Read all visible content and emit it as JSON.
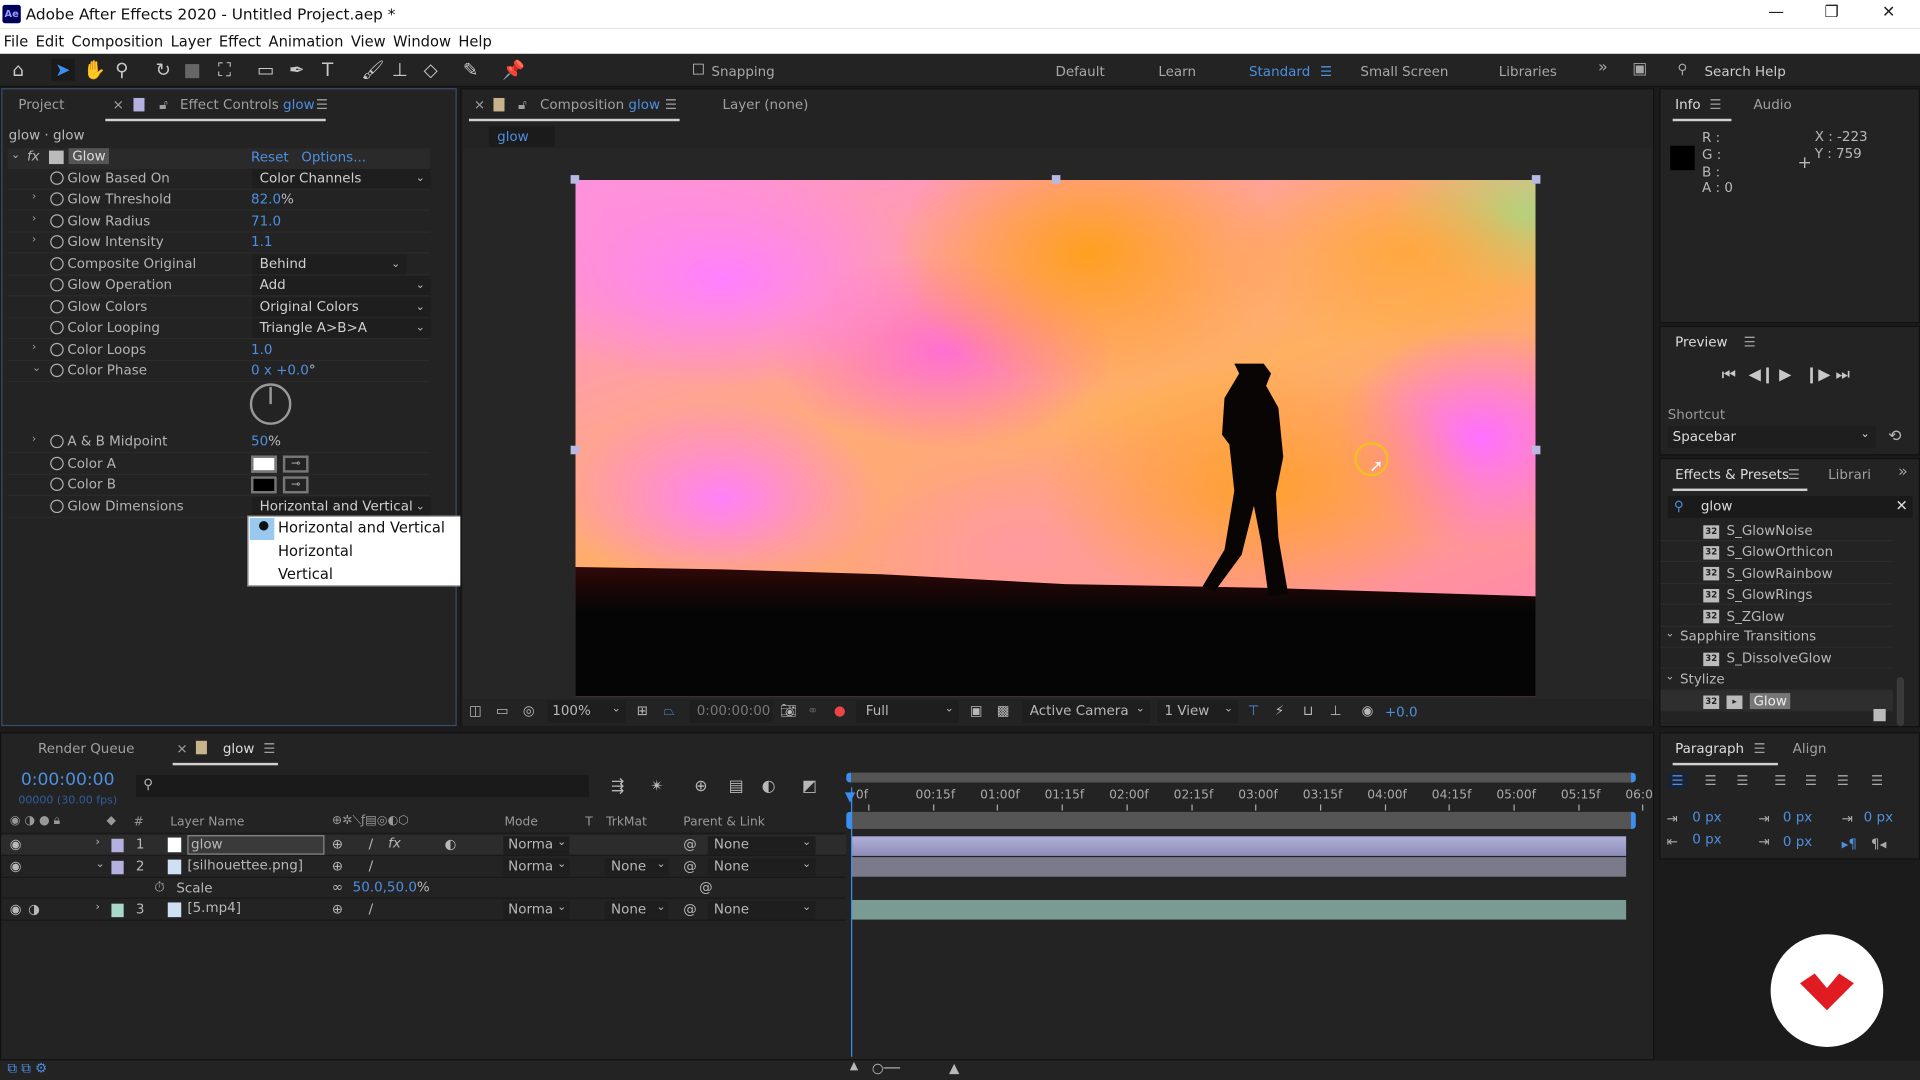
{
  "window": {
    "title": "Adobe After Effects 2020 - Untitled Project.aep *",
    "app_icon": "Ae",
    "controls": [
      "minimize",
      "restore",
      "close"
    ]
  },
  "menu": [
    "File",
    "Edit",
    "Composition",
    "Layer",
    "Effect",
    "Animation",
    "View",
    "Window",
    "Help"
  ],
  "toolbar": {
    "snapping": "Snapping",
    "workspaces": [
      "Default",
      "Learn",
      "Standard",
      "Small Screen",
      "Libraries"
    ],
    "active_workspace": "Standard",
    "search_help": "Search Help"
  },
  "left_panel": {
    "tab_project": "Project",
    "tab_effect_controls": "Effect Controls",
    "tab_effect_target": "glow",
    "breadcrumb": "glow · glow",
    "effect": {
      "name": "Glow",
      "reset": "Reset",
      "options": "Options...",
      "params": [
        {
          "label": "Glow Based On",
          "type": "dropdown",
          "value": "Color Channels"
        },
        {
          "label": "Glow Threshold",
          "type": "number",
          "value": "82.0",
          "unit": "%"
        },
        {
          "label": "Glow Radius",
          "type": "number",
          "value": "71.0"
        },
        {
          "label": "Glow Intensity",
          "type": "number",
          "value": "1.1"
        },
        {
          "label": "Composite Original",
          "type": "dropdown",
          "value": "Behind"
        },
        {
          "label": "Glow Operation",
          "type": "dropdown",
          "value": "Add"
        },
        {
          "label": "Glow Colors",
          "type": "dropdown",
          "value": "Original Colors"
        },
        {
          "label": "Color Looping",
          "type": "dropdown",
          "value": "Triangle A>B>A"
        },
        {
          "label": "Color Loops",
          "type": "number",
          "value": "1.0"
        },
        {
          "label": "Color Phase",
          "type": "angle",
          "value": "0 x +0.0",
          "unit": "°"
        },
        {
          "label": "A & B Midpoint",
          "type": "number",
          "value": "50",
          "unit": "%"
        },
        {
          "label": "Color A",
          "type": "color",
          "value": "#ffffff"
        },
        {
          "label": "Color B",
          "type": "color",
          "value": "#000000"
        },
        {
          "label": "Glow Dimensions",
          "type": "dropdown",
          "value": "Horizontal and Vertical"
        }
      ]
    },
    "dropdown_menu": {
      "options": [
        "Horizontal and Vertical",
        "Horizontal",
        "Vertical"
      ],
      "selected": "Horizontal and Vertical"
    }
  },
  "composition": {
    "tab_label": "Composition",
    "tab_target": "glow",
    "layer_tab": "Layer  (none)",
    "sub_tab": "glow",
    "footer": {
      "zoom": "100%",
      "timecode": "0:00:00:00",
      "resolution": "Full",
      "camera": "Active Camera",
      "views": "1 View",
      "exposure": "+0.0"
    }
  },
  "info": {
    "tab": "Info",
    "tab_audio": "Audio",
    "r": "R :",
    "g": "G :",
    "b": "B :",
    "a": "A :",
    "a_value": "0",
    "x": "X : -223",
    "y": "Y : 759"
  },
  "preview": {
    "title": "Preview",
    "shortcut_label": "Shortcut",
    "shortcut_value": "Spacebar"
  },
  "effects_presets": {
    "tab": "Effects & Presets",
    "tab_libraries": "Librari",
    "search": "glow",
    "items": [
      {
        "label": "S_GlowNoise",
        "kind": "effect"
      },
      {
        "label": "S_GlowOrthicon",
        "kind": "effect"
      },
      {
        "label": "S_GlowRainbow",
        "kind": "effect"
      },
      {
        "label": "S_GlowRings",
        "kind": "effect"
      },
      {
        "label": "S_ZGlow",
        "kind": "effect"
      },
      {
        "label": "Sapphire Transitions",
        "kind": "category"
      },
      {
        "label": "S_DissolveGlow",
        "kind": "effect"
      },
      {
        "label": "Stylize",
        "kind": "category"
      },
      {
        "label": "Glow",
        "kind": "effect",
        "selected": true
      }
    ]
  },
  "paragraph": {
    "tab": "Paragraph",
    "tab_align": "Align",
    "indent_left": "0 px",
    "indent_right": "0 px",
    "space_before": "0 px",
    "space_after": "0 px",
    "first_line": "0 px"
  },
  "timeline": {
    "tab_render_queue": "Render Queue",
    "tab_comp": "glow",
    "timecode": "0:00:00:00",
    "frame_info": "00000 (30.00 fps)",
    "columns": {
      "num": "#",
      "layer_name": "Layer Name",
      "mode": "Mode",
      "t": "T",
      "trkmat": "TrkMat",
      "parent": "Parent & Link"
    },
    "layers": [
      {
        "num": "1",
        "name": "glow",
        "mode": "Normal",
        "trkmat": "",
        "parent": "None",
        "color": "#b4b0e0",
        "has_fx": true
      },
      {
        "num": "2",
        "name": "[silhouettee.png]",
        "mode": "Normal",
        "trkmat": "None",
        "parent": "None",
        "color": "#b4b0e0",
        "expanded": true
      },
      {
        "num": "3",
        "name": "[5.mp4]",
        "mode": "Normal",
        "trkmat": "None",
        "parent": "None",
        "color": "#a8d8cc"
      }
    ],
    "scale_prop": {
      "label": "Scale",
      "value": "50.0,50.0",
      "unit": "%"
    },
    "ruler": [
      "0f",
      "00:15f",
      "01:00f",
      "01:15f",
      "02:00f",
      "02:15f",
      "03:00f",
      "03:15f",
      "04:00f",
      "04:15f",
      "05:00f",
      "05:15f",
      "06:0"
    ]
  },
  "colors": {
    "accent": "#4d8fe0",
    "panel": "#232323",
    "layer_purple": "#8c8cb8",
    "layer_teal": "#7a9a94"
  }
}
